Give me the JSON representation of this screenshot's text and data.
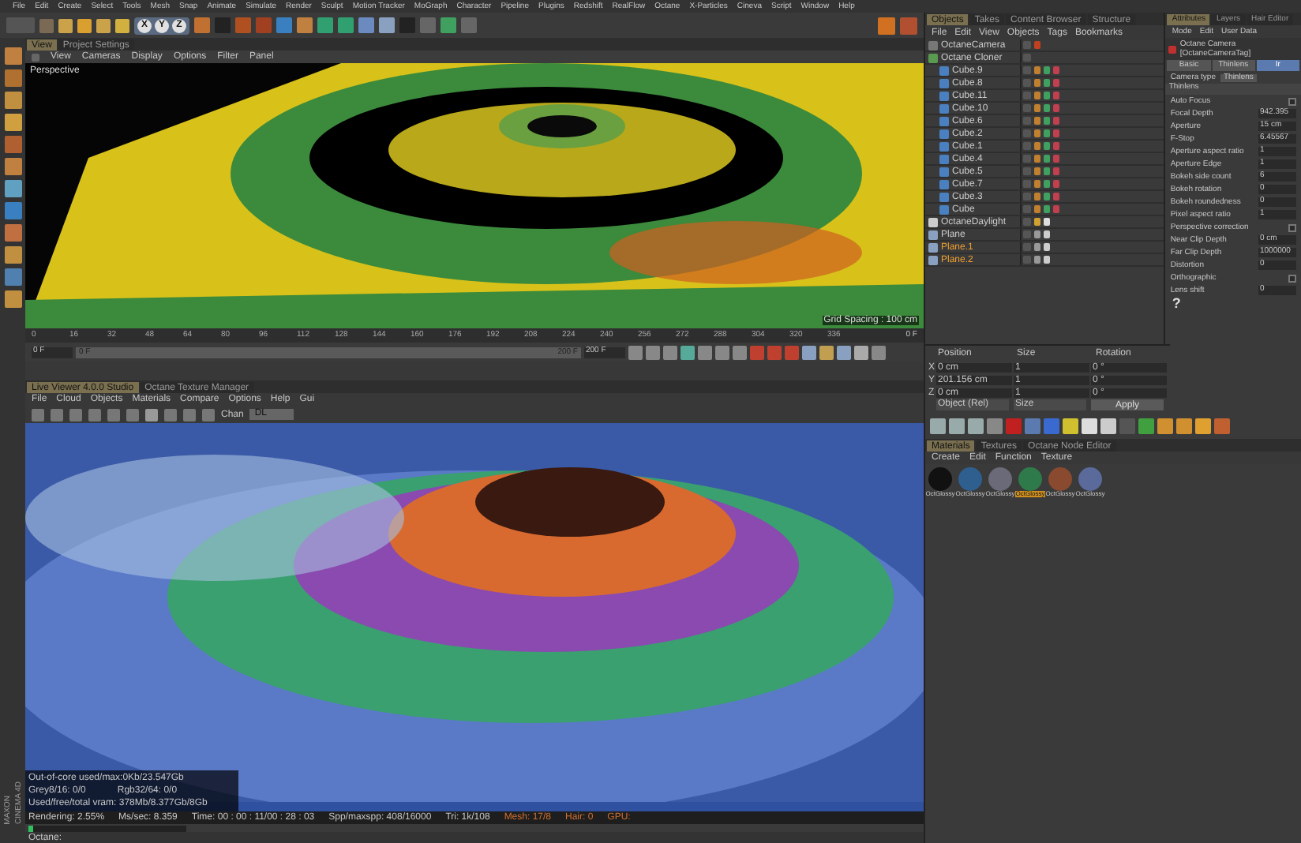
{
  "menu_bar": [
    "File",
    "Edit",
    "Create",
    "Select",
    "Tools",
    "Mesh",
    "Snap",
    "Animate",
    "Simulate",
    "Render",
    "Sculpt",
    "Motion Tracker",
    "MoGraph",
    "Character",
    "Pipeline",
    "Plugins",
    "Redshift",
    "RealFlow",
    "Octane",
    "X-Particles",
    "Cineva",
    "Script",
    "Window",
    "Help"
  ],
  "toolbar": {
    "axis_buttons": [
      "X",
      "Y",
      "Z"
    ]
  },
  "viewport": {
    "tabs": [
      {
        "label": "View",
        "selected": true
      },
      {
        "label": "Project Settings",
        "selected": false
      }
    ],
    "menu": [
      "View",
      "Cameras",
      "Display",
      "Options",
      "Filter",
      "Panel"
    ],
    "camera_label": "Perspective",
    "grid_spacing": "Grid Spacing : 100 cm"
  },
  "timeline": {
    "ticks": [
      "0",
      "16",
      "32",
      "48",
      "64",
      "80",
      "96",
      "112",
      "128",
      "144",
      "160",
      "176",
      "192",
      "208",
      "224",
      "240",
      "256",
      "272",
      "288",
      "304",
      "320",
      "336"
    ],
    "end_label": "0 F",
    "start_field": "0 F",
    "range_start": "0 F",
    "range_end": "200 F",
    "range": {
      "level": 1
    },
    "end_field": "200 F"
  },
  "live_viewer": {
    "tabs": [
      {
        "label": "Live Viewer 4.0.0 Studio",
        "selected": true
      },
      {
        "label": "Octane Texture Manager",
        "selected": false
      }
    ],
    "menu": [
      "File",
      "Cloud",
      "Objects",
      "Materials",
      "Compare",
      "Options",
      "Help",
      "Gui"
    ],
    "channel_label": "Chan",
    "channel_value": "DL",
    "stats": [
      "Out-of-core used/max:0Kb/23.547Gb",
      "Grey8/16: 0/0",
      "Rgb32/64: 0/0",
      "Used/free/total vram: 378Mb/8.377Gb/8Gb"
    ],
    "status": [
      "Rendering: 2.55%",
      "Ms/sec: 8.359",
      "Time: 00 : 00 : 11/00 : 28 : 03",
      "Spp/maxspp: 408/16000",
      "Tri: 1k/108",
      "Mesh: 17/8",
      "Hair: 0",
      "GPU:"
    ],
    "progress": {
      "level": 0.03
    },
    "brand": [
      "MAXON",
      "CINEMA 4D"
    ]
  },
  "status_bar": "Octane:",
  "object_manager": {
    "tabs": [
      {
        "label": "Objects",
        "selected": true
      },
      {
        "label": "Takes",
        "selected": false
      },
      {
        "label": "Content Browser",
        "selected": false
      },
      {
        "label": "Structure",
        "selected": false
      }
    ],
    "menu": [
      "File",
      "Edit",
      "View",
      "Objects",
      "Tags",
      "Bookmarks"
    ],
    "objects": [
      {
        "name": "OctaneCamera",
        "kind": "camera",
        "selected": false
      },
      {
        "name": "Octane Cloner",
        "kind": "cloner",
        "selected": false,
        "children": [
          {
            "name": "Cube.9",
            "kind": "cube",
            "selected": false
          },
          {
            "name": "Cube.8",
            "kind": "cube",
            "selected": false
          },
          {
            "name": "Cube.11",
            "kind": "cube",
            "selected": false
          },
          {
            "name": "Cube.10",
            "kind": "cube",
            "selected": false
          },
          {
            "name": "Cube.6",
            "kind": "cube",
            "selected": false
          },
          {
            "name": "Cube.2",
            "kind": "cube",
            "selected": false
          },
          {
            "name": "Cube.1",
            "kind": "cube",
            "selected": false
          },
          {
            "name": "Cube.4",
            "kind": "cube",
            "selected": false
          },
          {
            "name": "Cube.5",
            "kind": "cube",
            "selected": false
          },
          {
            "name": "Cube.7",
            "kind": "cube",
            "selected": false
          },
          {
            "name": "Cube.3",
            "kind": "cube",
            "selected": false
          },
          {
            "name": "Cube",
            "kind": "cube",
            "selected": false
          }
        ]
      },
      {
        "name": "OctaneDaylight",
        "kind": "light",
        "selected": false
      },
      {
        "name": "Plane",
        "kind": "plane",
        "selected": false
      },
      {
        "name": "Plane.1",
        "kind": "plane",
        "selected": true
      },
      {
        "name": "Plane.2",
        "kind": "plane",
        "selected": true
      }
    ]
  },
  "attribute_manager": {
    "tabs": [
      {
        "label": "Attributes",
        "selected": true
      },
      {
        "label": "Layers",
        "selected": false
      },
      {
        "label": "Hair Editor",
        "selected": false
      }
    ],
    "menu": [
      "Mode",
      "Edit",
      "User Data"
    ],
    "object_title": "Octane Camera [OctaneCameraTag]",
    "sub_tabs": [
      {
        "label": "Basic",
        "selected": false
      },
      {
        "label": "Thinlens",
        "selected": false
      },
      {
        "label": "Ir",
        "selected": true
      }
    ],
    "camera_type_label": "Camera type",
    "camera_type": "Thinlens",
    "section": "Thinlens",
    "params": [
      {
        "kind": "checkbox",
        "label": "Auto Focus",
        "checked": false
      },
      {
        "kind": "number",
        "label": "Focal Depth",
        "value": "942.395"
      },
      {
        "kind": "number",
        "label": "Aperture",
        "value": "15 cm"
      },
      {
        "kind": "number",
        "label": "F-Stop",
        "value": "6.45567"
      },
      {
        "kind": "number",
        "label": "Aperture aspect ratio",
        "value": "1"
      },
      {
        "kind": "number",
        "label": "Aperture Edge",
        "value": "1"
      },
      {
        "kind": "number",
        "label": "Bokeh side count",
        "value": "6"
      },
      {
        "kind": "number",
        "label": "Bokeh rotation",
        "value": "0"
      },
      {
        "kind": "number",
        "label": "Bokeh roundedness",
        "value": "0"
      },
      {
        "kind": "number",
        "label": "Pixel aspect ratio",
        "value": "1"
      },
      {
        "kind": "checkbox",
        "label": "Perspective correction",
        "checked": false
      },
      {
        "kind": "number",
        "label": "Near Clip Depth",
        "value": "0 cm"
      },
      {
        "kind": "number",
        "label": "Far Clip Depth",
        "value": "1000000"
      },
      {
        "kind": "number",
        "label": "Distortion",
        "value": "0"
      },
      {
        "kind": "checkbox",
        "label": "Orthographic",
        "checked": false
      },
      {
        "kind": "number",
        "label": "Lens shift",
        "value": "0"
      }
    ],
    "help": "?"
  },
  "coordinates": {
    "headers": [
      "Position",
      "Size",
      "Rotation"
    ],
    "rows": [
      {
        "axis": "X",
        "position": "0 cm",
        "size": "1",
        "rotation": "0 °"
      },
      {
        "axis": "Y",
        "position": "201.156 cm",
        "size": "1",
        "rotation": "0 °"
      },
      {
        "axis": "Z",
        "position": "0 cm",
        "size": "1",
        "rotation": "0 °"
      }
    ],
    "mode": "Object (Rel)",
    "size_mode": "Size",
    "apply": "Apply"
  },
  "material_manager": {
    "tabs": [
      {
        "label": "Materials",
        "selected": true
      },
      {
        "label": "Textures",
        "selected": false
      },
      {
        "label": "Octane Node Editor",
        "selected": false
      }
    ],
    "menu": [
      "Create",
      "Edit",
      "Function",
      "Texture"
    ],
    "materials": [
      {
        "name": "OctGlossy",
        "color": "#111111",
        "selected": false
      },
      {
        "name": "OctGlossy",
        "color": "#2f5f8f",
        "selected": false
      },
      {
        "name": "OctGlossy",
        "color": "#6a6a78",
        "selected": false
      },
      {
        "name": "OctGlossy",
        "color": "#2f7a4a",
        "selected": true
      },
      {
        "name": "OctGlossy",
        "color": "#8a4a30",
        "selected": false
      },
      {
        "name": "OctGlossy",
        "color": "#5a6a9a",
        "selected": false
      }
    ]
  }
}
